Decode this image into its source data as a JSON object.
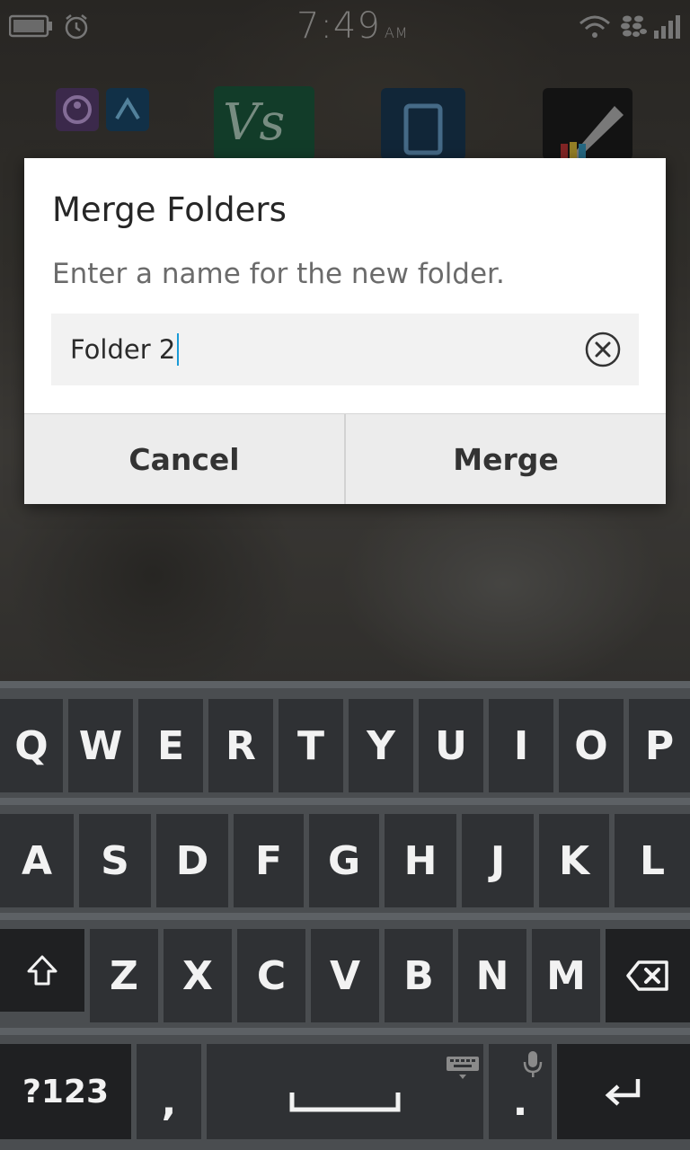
{
  "status_bar": {
    "time": "7:49",
    "ampm": "AM",
    "icons": [
      "battery-icon",
      "alarm-icon",
      "wifi-icon",
      "blackberry-icon",
      "signal-icon"
    ]
  },
  "dialog": {
    "title": "Merge Folders",
    "message": "Enter a name for the new folder.",
    "input_value": "Folder 2",
    "cancel_label": "Cancel",
    "merge_label": "Merge"
  },
  "keyboard": {
    "row1": [
      "Q",
      "W",
      "E",
      "R",
      "T",
      "Y",
      "U",
      "I",
      "O",
      "P"
    ],
    "row2": [
      "A",
      "S",
      "D",
      "F",
      "G",
      "H",
      "J",
      "K",
      "L"
    ],
    "row3": [
      "Z",
      "X",
      "C",
      "V",
      "B",
      "N",
      "M"
    ],
    "symbols_label": "?123",
    "comma_label": ",",
    "period_label": ".",
    "icons": [
      "shift-icon",
      "backspace-icon",
      "space-bar-icon",
      "keyboard-icon",
      "microphone-icon",
      "enter-icon"
    ]
  },
  "colors": {
    "accent_caret": "#1a9bd7",
    "dialog_bg": "#ffffff",
    "keyboard_bg": "#4a4d50",
    "key_bg": "#2f3134"
  }
}
